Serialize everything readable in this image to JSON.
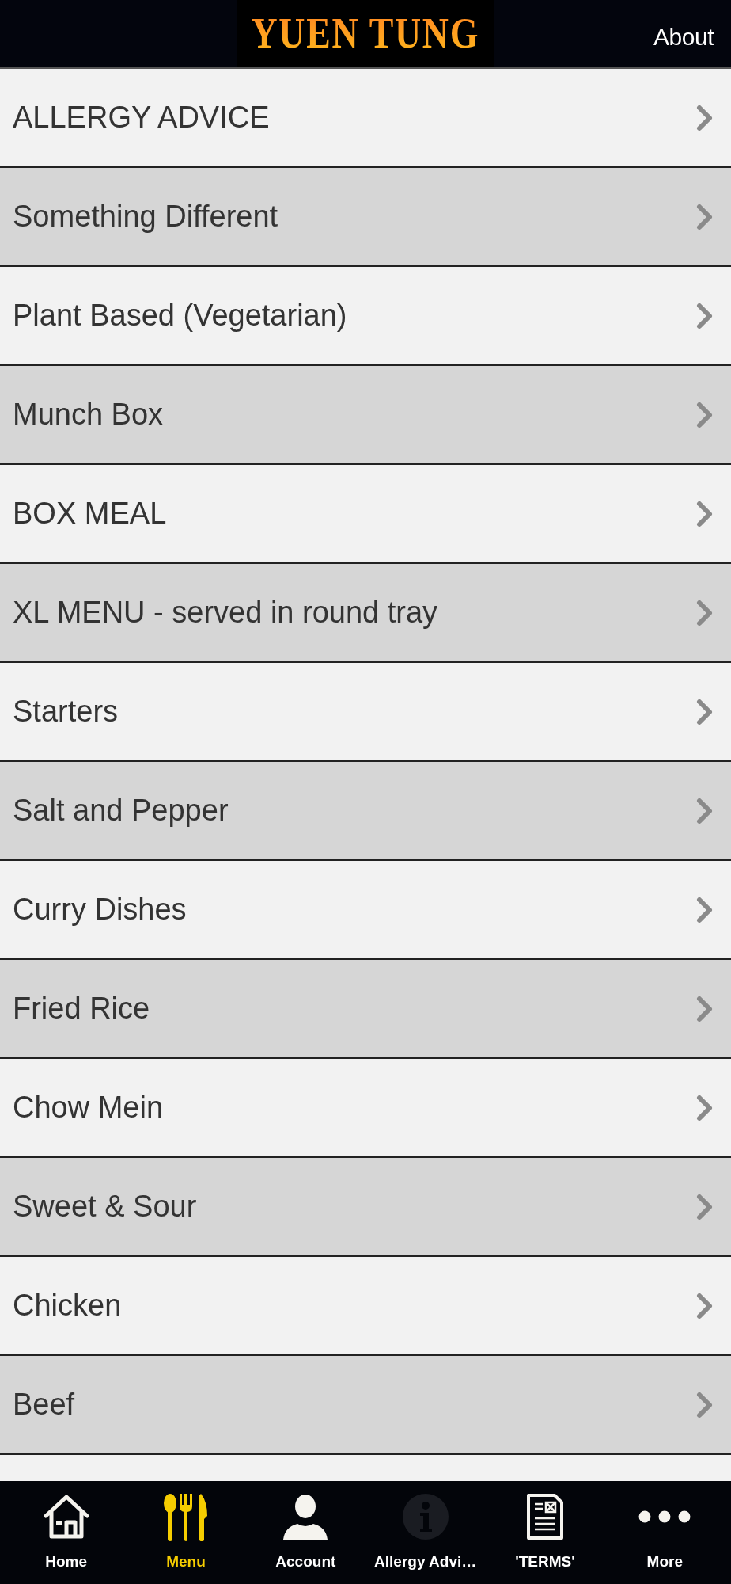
{
  "header": {
    "logo": "YUEN TUNG",
    "about": "About"
  },
  "menu_items": [
    {
      "label": "ALLERGY ADVICE"
    },
    {
      "label": "Something Different"
    },
    {
      "label": "Plant Based (Vegetarian)"
    },
    {
      "label": "Munch Box"
    },
    {
      "label": "BOX MEAL"
    },
    {
      "label": "XL MENU - served in round tray"
    },
    {
      "label": "Starters"
    },
    {
      "label": "Salt and Pepper"
    },
    {
      "label": "Curry Dishes"
    },
    {
      "label": "Fried Rice"
    },
    {
      "label": "Chow Mein"
    },
    {
      "label": "Sweet & Sour"
    },
    {
      "label": "Chicken"
    },
    {
      "label": "Beef"
    }
  ],
  "tab_bar": [
    {
      "kind": "home",
      "label": "Home",
      "selected": false
    },
    {
      "kind": "menu",
      "label": "Menu",
      "selected": true
    },
    {
      "kind": "account",
      "label": "Account",
      "selected": false
    },
    {
      "kind": "info",
      "label": "Allergy Advi…",
      "selected": false
    },
    {
      "kind": "document",
      "label": "'TERMS'",
      "selected": false
    },
    {
      "kind": "more",
      "label": "More",
      "selected": false
    }
  ]
}
